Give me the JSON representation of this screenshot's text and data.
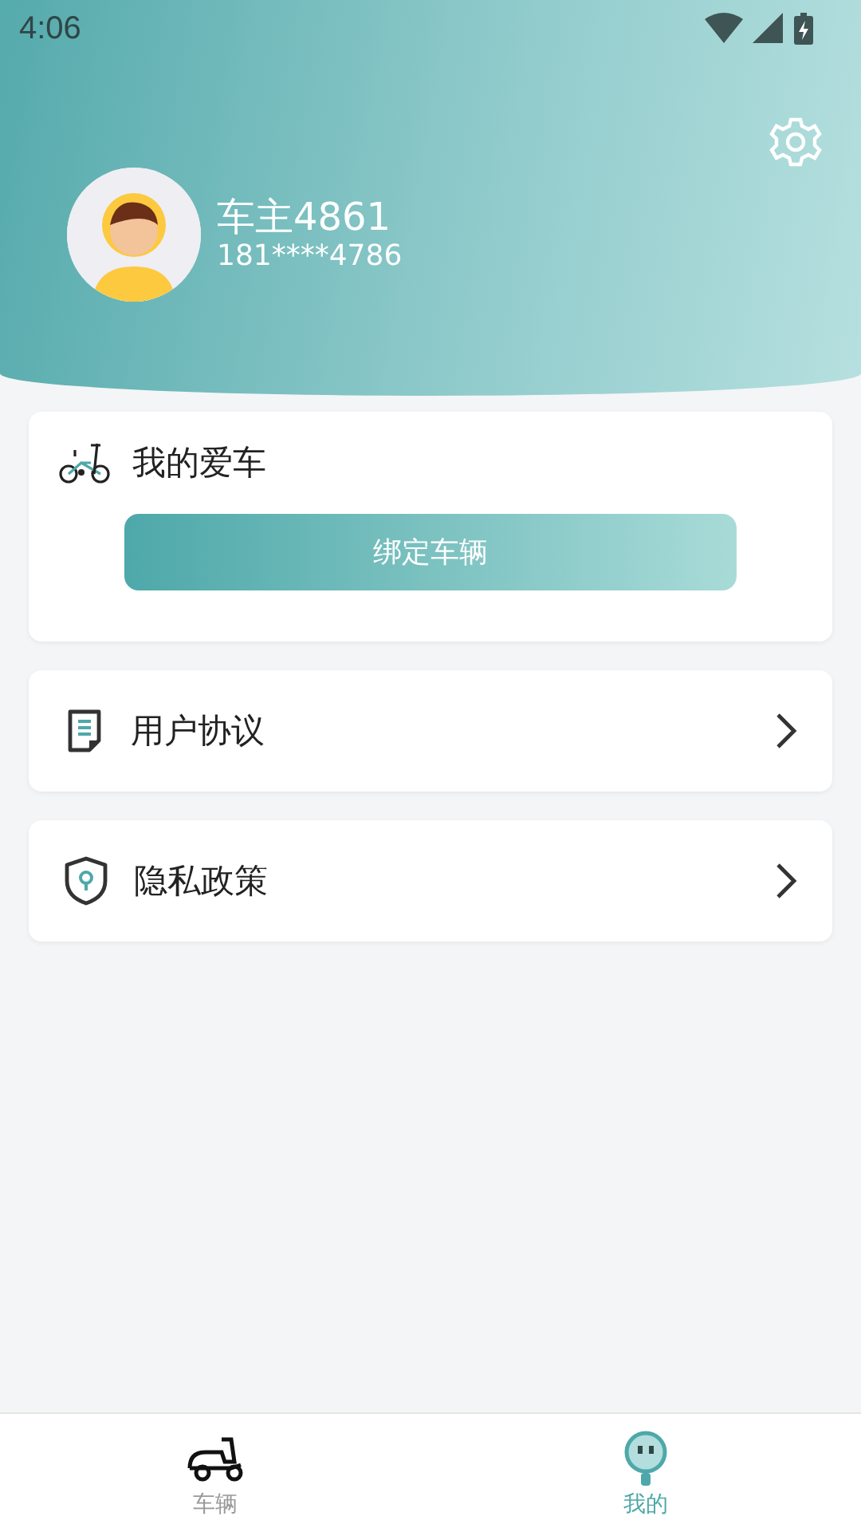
{
  "status_bar": {
    "time": "4:06"
  },
  "profile": {
    "name": "车主4861",
    "phone": "181****4786"
  },
  "my_car": {
    "title": "我的爱车",
    "button": "绑定车辆"
  },
  "menu": [
    {
      "kind": "agreement",
      "label": "用户协议"
    },
    {
      "kind": "privacy",
      "label": "隐私政策"
    }
  ],
  "tabs": [
    {
      "kind": "vehicle",
      "label": "车辆",
      "selected": false
    },
    {
      "kind": "me",
      "label": "我的",
      "selected": true
    }
  ]
}
